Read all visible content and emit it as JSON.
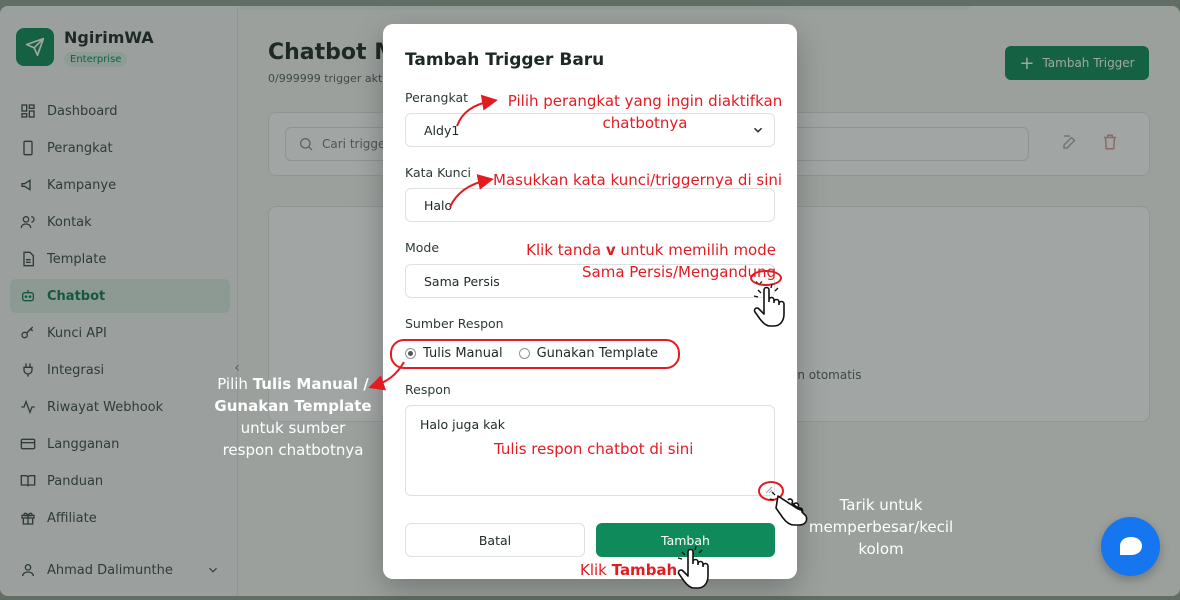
{
  "app": {
    "brand_name": "NgirimWA",
    "brand_badge": "Enterprise",
    "nav": [
      {
        "label": "Dashboard",
        "icon": "dashboard-icon"
      },
      {
        "label": "Perangkat",
        "icon": "device-icon"
      },
      {
        "label": "Kampanye",
        "icon": "megaphone-icon"
      },
      {
        "label": "Kontak",
        "icon": "users-icon"
      },
      {
        "label": "Template",
        "icon": "file-icon"
      },
      {
        "label": "Chatbot",
        "icon": "bot-icon"
      },
      {
        "label": "Kunci API",
        "icon": "key-icon"
      },
      {
        "label": "Integrasi",
        "icon": "plug-icon"
      },
      {
        "label": "Riwayat Webhook",
        "icon": "activity-icon"
      },
      {
        "label": "Langganan",
        "icon": "card-icon"
      },
      {
        "label": "Panduan",
        "icon": "book-icon"
      },
      {
        "label": "Affiliate",
        "icon": "gift-icon"
      }
    ],
    "active_nav": "Chatbot",
    "user_name": "Ahmad Dalimunthe",
    "page_title": "Chatbot Ma",
    "page_subtitle": "0/999999 trigger akt",
    "add_trigger_label": "Tambah Trigger",
    "search_placeholder": "Cari trigge",
    "empty_text": "an otomatis"
  },
  "modal": {
    "title": "Tambah Trigger Baru",
    "device_label": "Perangkat",
    "device_value": "Aldy1",
    "keyword_label": "Kata Kunci",
    "keyword_value": "Halo",
    "mode_label": "Mode",
    "mode_value": "Sama Persis",
    "source_label": "Sumber Respon",
    "source_options": [
      "Tulis Manual",
      "Gunakan Template"
    ],
    "source_selected": "Tulis Manual",
    "response_label": "Respon",
    "response_value": "Halo juga kak",
    "cancel_label": "Batal",
    "submit_label": "Tambah"
  },
  "annotations": {
    "device_line1": "Pilih perangkat yang ingin diaktifkan",
    "device_line2": "chatbotnya",
    "keyword": "Masukkan kata kunci/triggernya di sini",
    "mode_pre": "Klik tanda ",
    "mode_bold": "v",
    "mode_post": " untuk memilih mode",
    "mode_line2": "Sama Persis/Mengandung",
    "source_pre": "Pilih ",
    "source_bold1": "Tulis Manual /",
    "source_bold2": "Gunakan Template",
    "source_line3": "untuk sumber",
    "source_line4": "respon chatbotnya",
    "response": "Tulis respon chatbot di sini",
    "resize_line1": "Tarik untuk",
    "resize_line2": "memperbesar/kecil",
    "resize_line3": "kolom",
    "click_pre": "Klik ",
    "click_bold": "Tambah"
  },
  "colors": {
    "primary": "#0f8a5a",
    "annotation_red": "#e31b23",
    "chat_fab": "#1676f0"
  }
}
